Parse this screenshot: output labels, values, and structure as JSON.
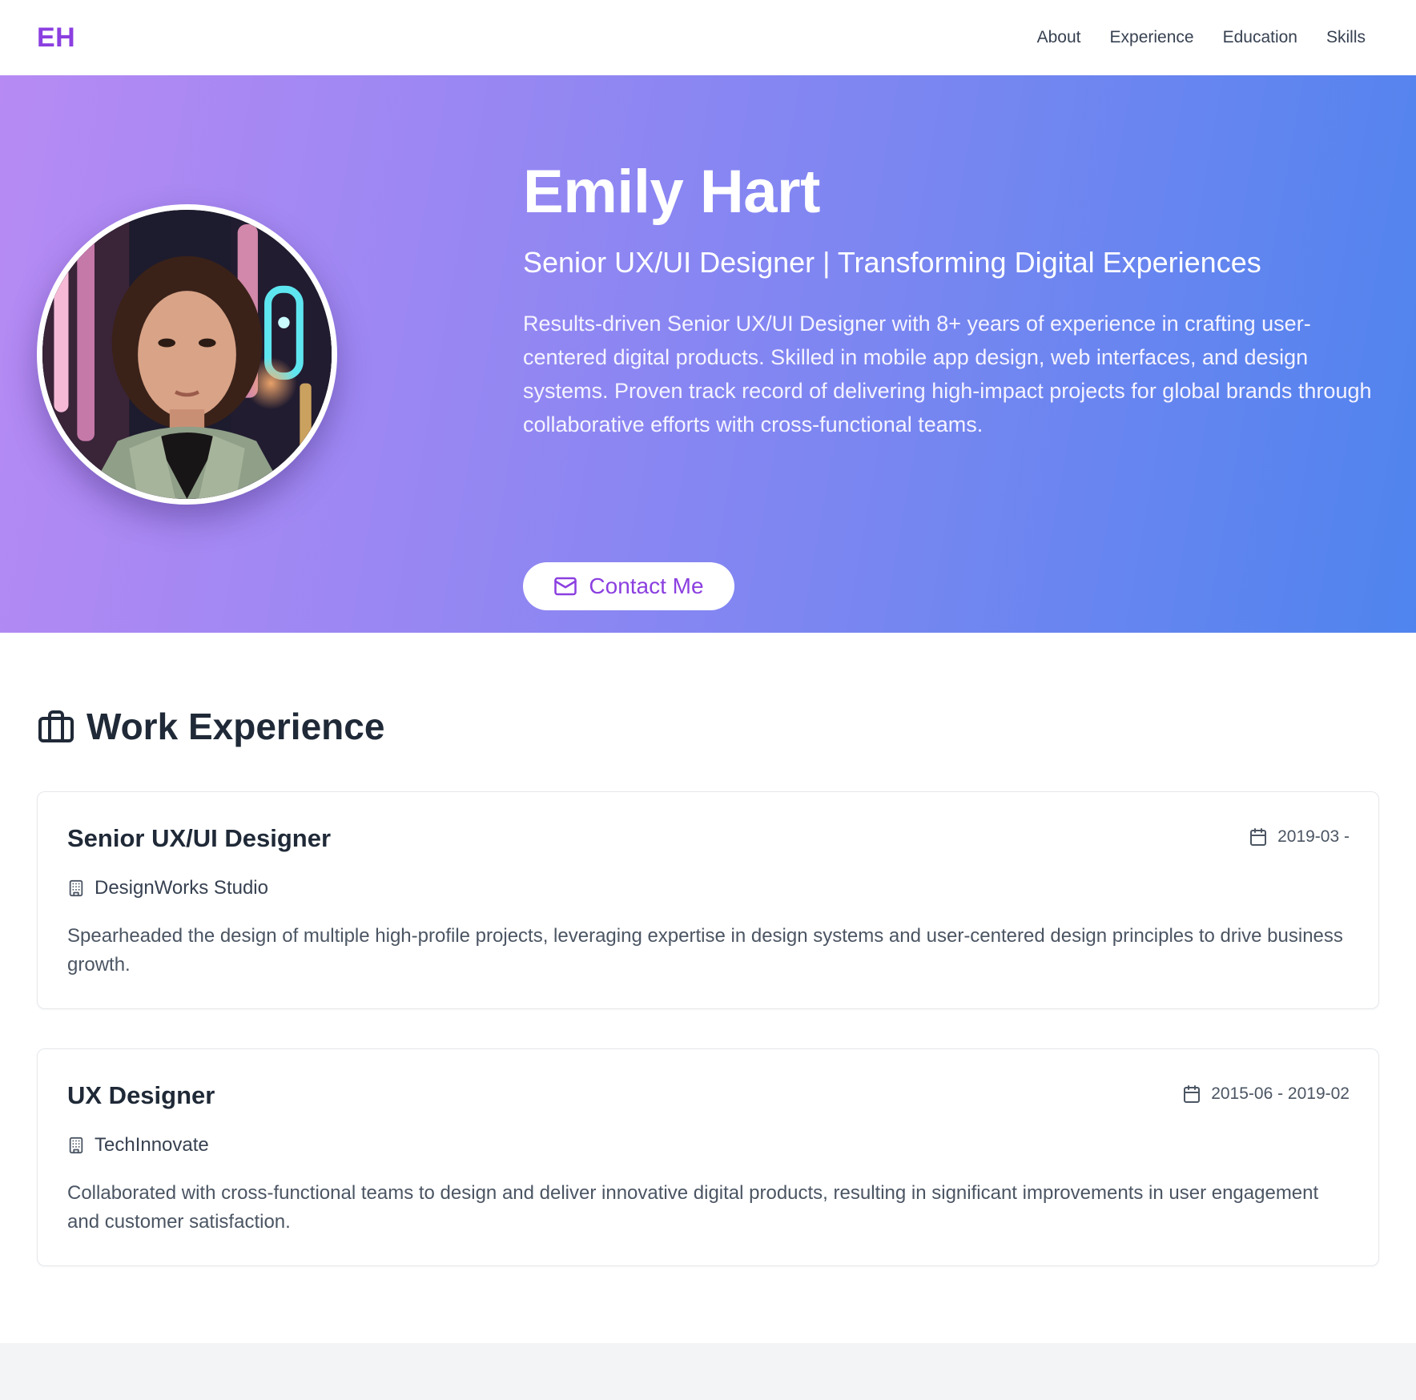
{
  "nav": {
    "logo": "EH",
    "links": [
      "About",
      "Experience",
      "Education",
      "Skills"
    ]
  },
  "hero": {
    "name": "Emily Hart",
    "title": "Senior UX/UI Designer | Transforming Digital Experiences",
    "summary": "Results-driven Senior UX/UI Designer with 8+ years of experience in crafting user-centered digital products. Skilled in mobile app design, web interfaces, and design systems. Proven track record of delivering high-impact projects for global brands through collaborative efforts with cross-functional teams.",
    "contact_label": "Contact Me"
  },
  "experience": {
    "heading": "Work Experience",
    "jobs": [
      {
        "role": "Senior UX/UI Designer",
        "date": "2019-03 -",
        "company": "DesignWorks Studio",
        "description": "Spearheaded the design of multiple high-profile projects, leveraging expertise in design systems and user-centered design principles to drive business growth."
      },
      {
        "role": "UX Designer",
        "date": "2015-06 - 2019-02",
        "company": "TechInnovate",
        "description": "Collaborated with cross-functional teams to design and deliver innovative digital products, resulting in significant improvements in user engagement and customer satisfaction."
      }
    ]
  },
  "colors": {
    "accent": "#8b3fe0",
    "gradient_start": "#b78af3",
    "gradient_end": "#4f84ee"
  },
  "icons": {
    "contact": "mail-icon",
    "section": "briefcase-icon",
    "date": "calendar-icon",
    "company": "building-icon"
  }
}
